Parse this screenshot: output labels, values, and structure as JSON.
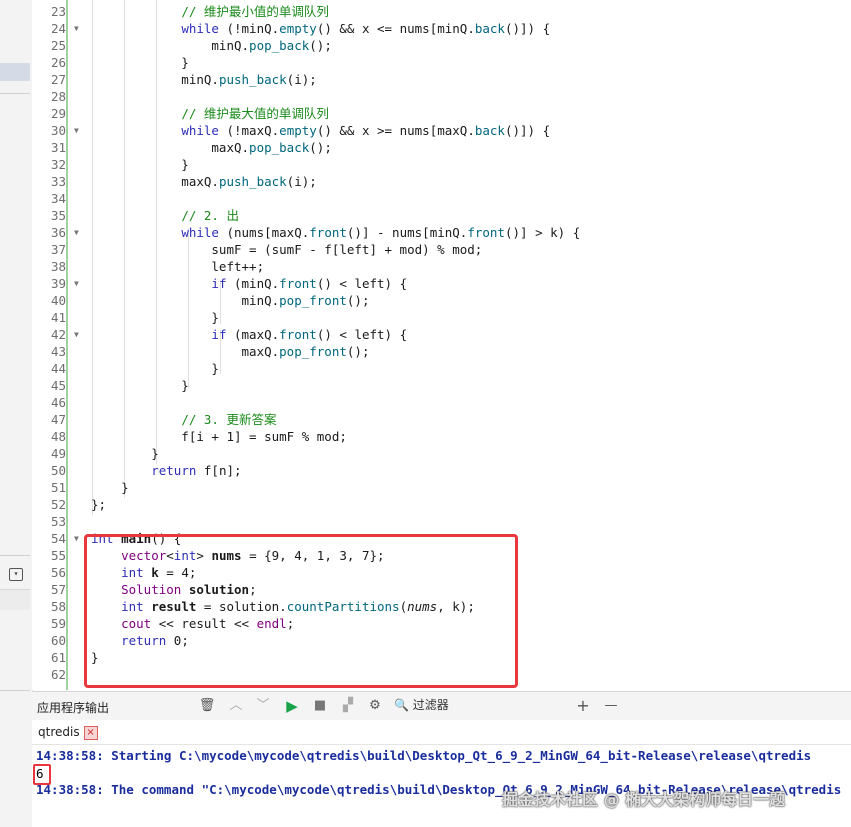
{
  "editor": {
    "lines": [
      {
        "n": "23",
        "fold": "",
        "segs": [
          [
            "            ",
            ""
          ],
          [
            "// 维护最小值的单调队列",
            "cm"
          ]
        ]
      },
      {
        "n": "24",
        "fold": "▼",
        "segs": [
          [
            "            ",
            ""
          ],
          [
            "while",
            "kw"
          ],
          [
            " (!minQ.",
            ""
          ],
          [
            "empty",
            "fn"
          ],
          [
            "() && x <= nums[minQ.",
            ""
          ],
          [
            "back",
            "fn"
          ],
          [
            "()]) {",
            ""
          ]
        ]
      },
      {
        "n": "25",
        "fold": "",
        "segs": [
          [
            "                minQ.",
            ""
          ],
          [
            "pop_back",
            "fn"
          ],
          [
            "();",
            ""
          ]
        ]
      },
      {
        "n": "26",
        "fold": "",
        "segs": [
          [
            "            }",
            ""
          ]
        ]
      },
      {
        "n": "27",
        "fold": "",
        "segs": [
          [
            "            minQ.",
            ""
          ],
          [
            "push_back",
            "fn"
          ],
          [
            "(i);",
            ""
          ]
        ]
      },
      {
        "n": "28",
        "fold": "",
        "segs": [
          [
            "",
            ""
          ]
        ]
      },
      {
        "n": "29",
        "fold": "",
        "segs": [
          [
            "            ",
            ""
          ],
          [
            "// 维护最大值的单调队列",
            "cm"
          ]
        ]
      },
      {
        "n": "30",
        "fold": "▼",
        "segs": [
          [
            "            ",
            ""
          ],
          [
            "while",
            "kw"
          ],
          [
            " (!maxQ.",
            ""
          ],
          [
            "empty",
            "fn"
          ],
          [
            "() && x >= nums[maxQ.",
            ""
          ],
          [
            "back",
            "fn"
          ],
          [
            "()]) {",
            ""
          ]
        ]
      },
      {
        "n": "31",
        "fold": "",
        "segs": [
          [
            "                maxQ.",
            ""
          ],
          [
            "pop_back",
            "fn"
          ],
          [
            "();",
            ""
          ]
        ]
      },
      {
        "n": "32",
        "fold": "",
        "segs": [
          [
            "            }",
            ""
          ]
        ]
      },
      {
        "n": "33",
        "fold": "",
        "segs": [
          [
            "            maxQ.",
            ""
          ],
          [
            "push_back",
            "fn"
          ],
          [
            "(i);",
            ""
          ]
        ]
      },
      {
        "n": "34",
        "fold": "",
        "segs": [
          [
            "",
            ""
          ]
        ]
      },
      {
        "n": "35",
        "fold": "",
        "segs": [
          [
            "            ",
            ""
          ],
          [
            "// 2. 出",
            "cm"
          ]
        ]
      },
      {
        "n": "36",
        "fold": "▼",
        "segs": [
          [
            "            ",
            ""
          ],
          [
            "while",
            "kw"
          ],
          [
            " (nums[maxQ.",
            ""
          ],
          [
            "front",
            "fn"
          ],
          [
            "()] - nums[minQ.",
            ""
          ],
          [
            "front",
            "fn"
          ],
          [
            "()] > k) {",
            ""
          ]
        ]
      },
      {
        "n": "37",
        "fold": "",
        "segs": [
          [
            "                sumF = (sumF - f[left] + mod) % mod;",
            ""
          ]
        ]
      },
      {
        "n": "38",
        "fold": "",
        "segs": [
          [
            "                left++;",
            ""
          ]
        ]
      },
      {
        "n": "39",
        "fold": "▼",
        "segs": [
          [
            "                ",
            ""
          ],
          [
            "if",
            "kw"
          ],
          [
            " (minQ.",
            ""
          ],
          [
            "front",
            "fn"
          ],
          [
            "() < left) {",
            ""
          ]
        ]
      },
      {
        "n": "40",
        "fold": "",
        "segs": [
          [
            "                    minQ.",
            ""
          ],
          [
            "pop_front",
            "fn"
          ],
          [
            "();",
            ""
          ]
        ]
      },
      {
        "n": "41",
        "fold": "",
        "segs": [
          [
            "                }",
            ""
          ]
        ]
      },
      {
        "n": "42",
        "fold": "▼",
        "segs": [
          [
            "                ",
            ""
          ],
          [
            "if",
            "kw"
          ],
          [
            " (maxQ.",
            ""
          ],
          [
            "front",
            "fn"
          ],
          [
            "() < left) {",
            ""
          ]
        ]
      },
      {
        "n": "43",
        "fold": "",
        "segs": [
          [
            "                    maxQ.",
            ""
          ],
          [
            "pop_front",
            "fn"
          ],
          [
            "();",
            ""
          ]
        ]
      },
      {
        "n": "44",
        "fold": "",
        "segs": [
          [
            "                }",
            ""
          ]
        ]
      },
      {
        "n": "45",
        "fold": "",
        "segs": [
          [
            "            }",
            ""
          ]
        ]
      },
      {
        "n": "46",
        "fold": "",
        "segs": [
          [
            "",
            ""
          ]
        ]
      },
      {
        "n": "47",
        "fold": "",
        "segs": [
          [
            "            ",
            ""
          ],
          [
            "// 3. 更新答案",
            "cm"
          ]
        ]
      },
      {
        "n": "48",
        "fold": "",
        "segs": [
          [
            "            f[i + 1] = sumF % mod;",
            ""
          ]
        ]
      },
      {
        "n": "49",
        "fold": "",
        "segs": [
          [
            "        }",
            ""
          ]
        ]
      },
      {
        "n": "50",
        "fold": "",
        "segs": [
          [
            "        ",
            ""
          ],
          [
            "return",
            "kw"
          ],
          [
            " f[n];",
            ""
          ]
        ]
      },
      {
        "n": "51",
        "fold": "",
        "segs": [
          [
            "    }",
            ""
          ]
        ]
      },
      {
        "n": "52",
        "fold": "",
        "segs": [
          [
            "};",
            ""
          ]
        ]
      },
      {
        "n": "53",
        "fold": "",
        "segs": [
          [
            "",
            ""
          ]
        ]
      },
      {
        "n": "54",
        "fold": "▼",
        "segs": [
          [
            "int",
            "kw"
          ],
          [
            " ",
            ""
          ],
          [
            "main",
            "b"
          ],
          [
            "() {",
            ""
          ]
        ]
      },
      {
        "n": "55",
        "fold": "",
        "segs": [
          [
            "    ",
            ""
          ],
          [
            "vector",
            "ty"
          ],
          [
            "<",
            ""
          ],
          [
            "int",
            "kw"
          ],
          [
            "> ",
            ""
          ],
          [
            "nums",
            "b"
          ],
          [
            " = {9, 4, 1, 3, 7};",
            ""
          ]
        ]
      },
      {
        "n": "56",
        "fold": "",
        "segs": [
          [
            "    ",
            ""
          ],
          [
            "int",
            "kw"
          ],
          [
            " ",
            ""
          ],
          [
            "k",
            "b"
          ],
          [
            " = 4;",
            ""
          ]
        ]
      },
      {
        "n": "57",
        "fold": "",
        "segs": [
          [
            "    ",
            ""
          ],
          [
            "Solution",
            "ty"
          ],
          [
            " ",
            ""
          ],
          [
            "solution",
            "b"
          ],
          [
            ";",
            ""
          ]
        ]
      },
      {
        "n": "58",
        "fold": "",
        "segs": [
          [
            "    ",
            ""
          ],
          [
            "int",
            "kw"
          ],
          [
            " ",
            ""
          ],
          [
            "result",
            "b"
          ],
          [
            " = solution.",
            ""
          ],
          [
            "countPartitions",
            "fn"
          ],
          [
            "(",
            ""
          ],
          [
            "nums",
            "it"
          ],
          [
            ", k);",
            ""
          ]
        ]
      },
      {
        "n": "59",
        "fold": "",
        "segs": [
          [
            "    ",
            ""
          ],
          [
            "cout",
            "ty"
          ],
          [
            " << result << ",
            ""
          ],
          [
            "endl",
            "ty"
          ],
          [
            ";",
            ""
          ]
        ]
      },
      {
        "n": "60",
        "fold": "",
        "segs": [
          [
            "    ",
            ""
          ],
          [
            "return",
            "kw"
          ],
          [
            " 0;",
            ""
          ]
        ]
      },
      {
        "n": "61",
        "fold": "",
        "segs": [
          [
            "}",
            ""
          ]
        ]
      },
      {
        "n": "62",
        "fold": "",
        "segs": [
          [
            "",
            ""
          ]
        ]
      }
    ]
  },
  "panel": {
    "title": "应用程序输出",
    "filter_label": "过滤器",
    "icons": [
      "trash-icon",
      "up-icon",
      "down-icon",
      "run-icon",
      "stop-icon",
      "attach-icon",
      "gear-icon"
    ],
    "add_label": "+",
    "minus_label": "—",
    "tab_label": "qtredis",
    "tab_close": "×"
  },
  "output": {
    "line1": "14:38:58: Starting C:\\mycode\\mycode\\qtredis\\build\\Desktop_Qt_6_9_2_MinGW_64_bit-Release\\release\\qtredis",
    "line2": "6",
    "line3": "14:38:58: The command \"C:\\mycode\\mycode\\qtredis\\build\\Desktop_Qt_6_9_2_MinGW_64_bit-Release\\release\\qtredis",
    "watermark": "掘金技术社区 @ 椭大大架构师每日一题"
  },
  "colors": {
    "highlight": "#e8383d",
    "keyword": "#2d2db8",
    "comment": "#1a8a1a",
    "function": "#00677c",
    "type": "#800080"
  }
}
